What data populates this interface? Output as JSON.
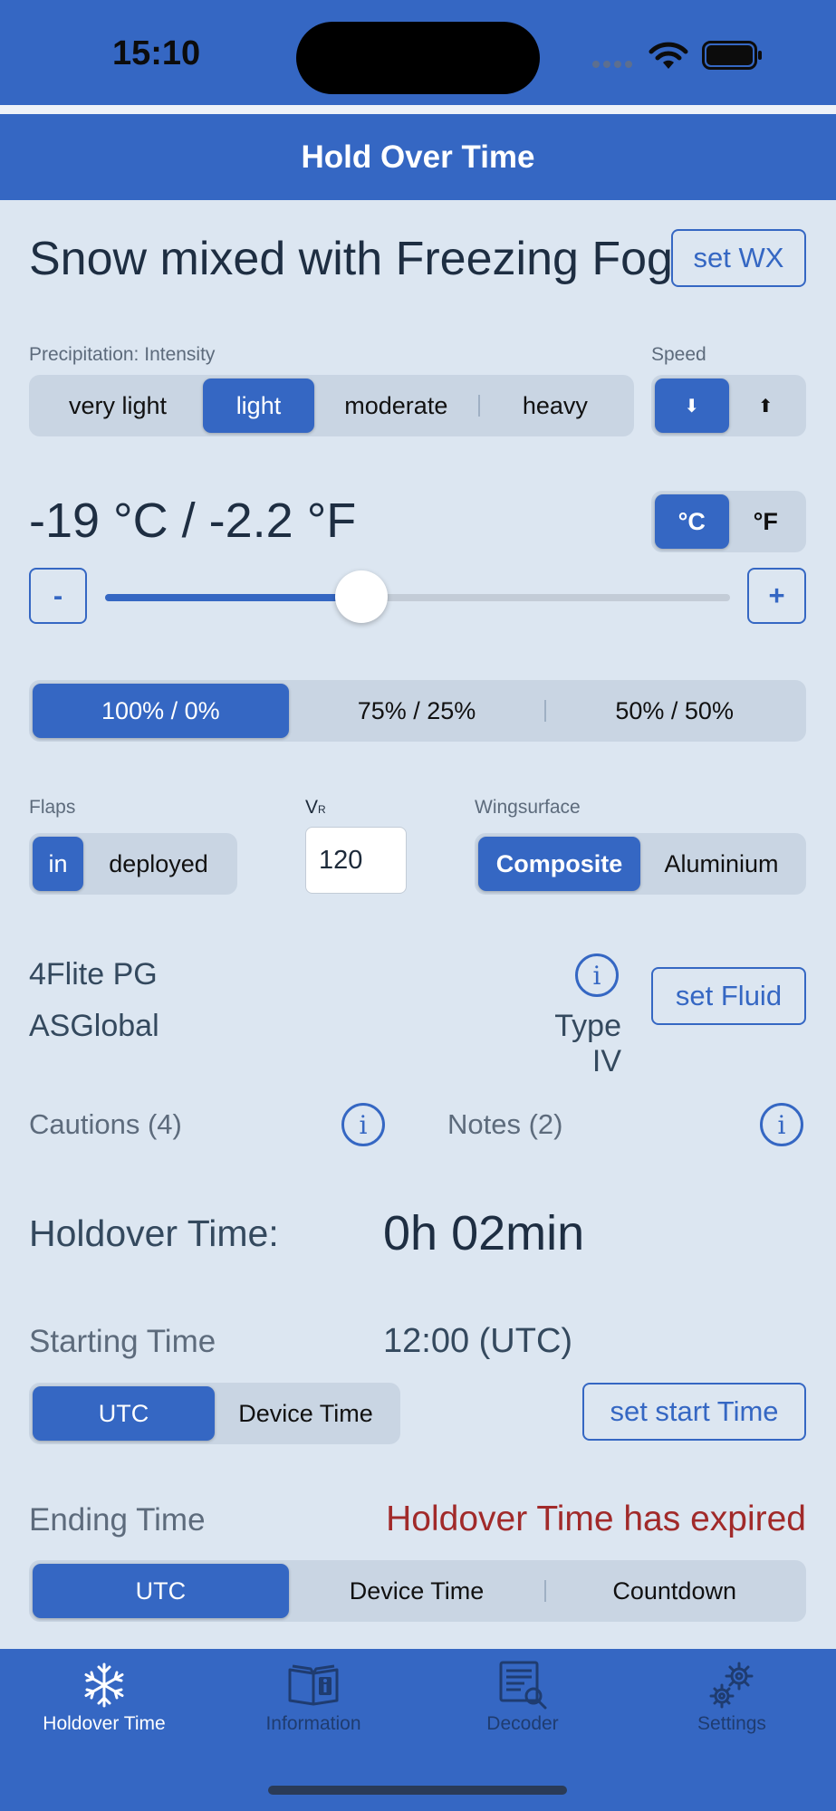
{
  "status": {
    "time": "15:10"
  },
  "header": {
    "title": "Hold Over Time"
  },
  "weather": {
    "condition": "Snow mixed with Freezing Fog",
    "set_label": "set WX"
  },
  "precipitation": {
    "label": "Precipitation: Intensity",
    "options": [
      "very light",
      "light",
      "moderate",
      "heavy"
    ],
    "selected": "light"
  },
  "speed": {
    "label": "Speed",
    "options": [
      "⬇",
      "⬆"
    ],
    "selected": "⬇"
  },
  "temperature": {
    "display": "-19 °C / -2.2 °F",
    "units": [
      "°C",
      "°F"
    ],
    "selected_unit": "°C",
    "minus_label": "-",
    "plus_label": "+",
    "slider_fraction": 0.41
  },
  "concentration": {
    "options": [
      "100% / 0%",
      "75% / 25%",
      "50% / 50%"
    ],
    "selected": "100% / 0%"
  },
  "flaps": {
    "label": "Flaps",
    "options": [
      "in",
      "deployed"
    ],
    "selected": "in"
  },
  "vr": {
    "label_main": "V",
    "label_sub": "R",
    "value": "120"
  },
  "wingsurface": {
    "label": "Wingsurface",
    "options": [
      "Composite",
      "Aluminium"
    ],
    "selected": "Composite"
  },
  "fluid": {
    "name": "4Flite PG",
    "maker": "ASGlobal",
    "type": "Type IV",
    "set_label": "set Fluid"
  },
  "cautions": {
    "label": "Cautions (4)"
  },
  "notes": {
    "label": "Notes (2)"
  },
  "holdover": {
    "label": "Holdover Time:",
    "value": "0h 02min"
  },
  "starting": {
    "label": "Starting Time",
    "value": "12:00 (UTC)",
    "options": [
      "UTC",
      "Device Time"
    ],
    "selected": "UTC",
    "set_label": "set start Time"
  },
  "ending": {
    "label": "Ending Time",
    "value": "Holdover Time has expired",
    "options": [
      "UTC",
      "Device Time",
      "Countdown"
    ],
    "selected": "UTC"
  },
  "tabs": [
    {
      "label": "Holdover Time",
      "icon": "snowflake-icon"
    },
    {
      "label": "Information",
      "icon": "book-info-icon"
    },
    {
      "label": "Decoder",
      "icon": "document-search-icon"
    },
    {
      "label": "Settings",
      "icon": "gears-icon"
    }
  ],
  "colors": {
    "accent": "#3567c3",
    "background": "#dce6f1",
    "expired": "#a12a2a"
  }
}
